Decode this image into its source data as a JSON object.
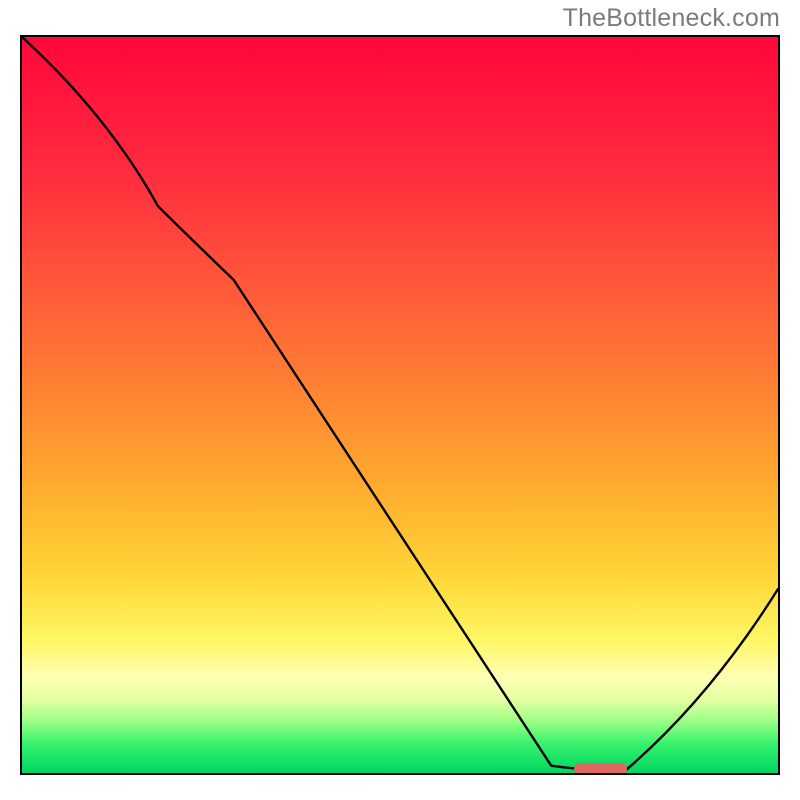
{
  "watermark": "TheBottleneck.com",
  "chart_data": {
    "type": "line",
    "title": "",
    "xlabel": "",
    "ylabel": "",
    "xlim": [
      0,
      100
    ],
    "ylim": [
      0,
      100
    ],
    "grid": false,
    "legend": false,
    "series": [
      {
        "name": "bottleneck-curve",
        "x": [
          0,
          18,
          28,
          70,
          80,
          100
        ],
        "y": [
          100,
          77,
          67,
          1,
          0.5,
          25
        ]
      }
    ],
    "marker": {
      "x_start": 73,
      "x_end": 80,
      "y": 0.5,
      "color": "#e06666"
    },
    "background_gradient": {
      "type": "vertical",
      "stops": [
        {
          "pct": 0,
          "color": "#ff073a"
        },
        {
          "pct": 18,
          "color": "#ff2b3f"
        },
        {
          "pct": 40,
          "color": "#ff6a37"
        },
        {
          "pct": 60,
          "color": "#ffa82e"
        },
        {
          "pct": 73,
          "color": "#ffd537"
        },
        {
          "pct": 82,
          "color": "#fff765"
        },
        {
          "pct": 87,
          "color": "#ffffb4"
        },
        {
          "pct": 90,
          "color": "#e4ffa0"
        },
        {
          "pct": 93,
          "color": "#9bff86"
        },
        {
          "pct": 96,
          "color": "#37f26d"
        },
        {
          "pct": 100,
          "color": "#00d561"
        }
      ]
    }
  }
}
